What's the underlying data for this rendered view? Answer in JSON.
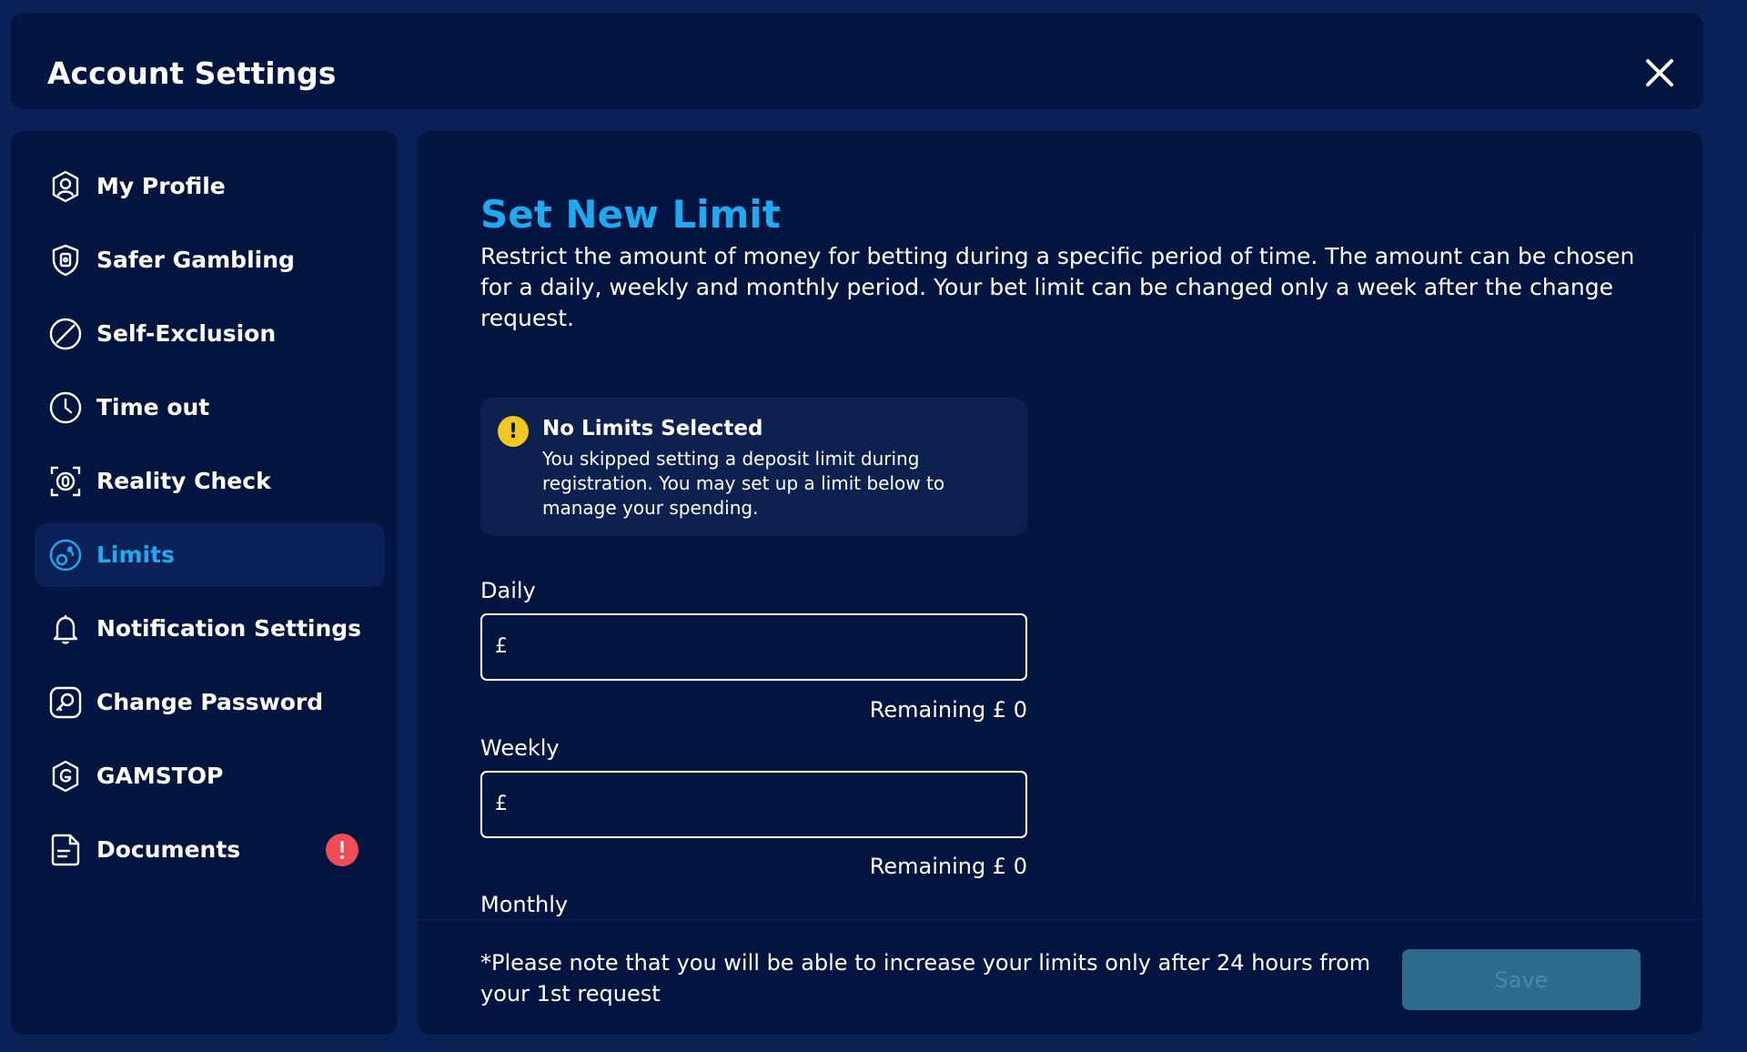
{
  "header": {
    "title": "Account Settings",
    "close_icon": "close-icon"
  },
  "sidebar": {
    "items": [
      {
        "label": "My Profile",
        "icon": "user-icon"
      },
      {
        "label": "Safer Gambling",
        "icon": "shield-icon"
      },
      {
        "label": "Self-Exclusion",
        "icon": "block-icon"
      },
      {
        "label": "Time out",
        "icon": "clock-icon"
      },
      {
        "label": "Reality Check",
        "icon": "reality-check-icon"
      },
      {
        "label": "Limits",
        "icon": "limits-icon",
        "active": true
      },
      {
        "label": "Notification Settings",
        "icon": "bell-icon"
      },
      {
        "label": "Change Password",
        "icon": "key-icon"
      },
      {
        "label": "GAMSTOP",
        "icon": "gamstop-icon"
      },
      {
        "label": "Documents",
        "icon": "document-icon",
        "badge": "!"
      }
    ]
  },
  "main": {
    "title": "Set New Limit",
    "description": "Restrict the amount of money for betting during a specific period of time. The amount can be chosen for a daily, weekly and monthly period. Your bet limit can be changed only a week after the change request.",
    "alert": {
      "icon": "!",
      "title": "No Limits Selected",
      "text": "You skipped setting a deposit limit during registration. You may set up a limit below to manage your spending."
    },
    "fields": [
      {
        "label": "Daily",
        "currency": "£",
        "value": "",
        "remaining": "Remaining £ 0"
      },
      {
        "label": "Weekly",
        "currency": "£",
        "value": "",
        "remaining": "Remaining £ 0"
      },
      {
        "label": "Monthly"
      }
    ]
  },
  "footer": {
    "note": "*Please note that you will be able to increase your limits only after 24 hours from your 1st request",
    "save_label": "Save"
  },
  "colors": {
    "background": "#0a2258",
    "panel": "#021540",
    "accent": "#1fa9f0",
    "warning": "#f3c620",
    "danger": "#f04d56",
    "save_button": "#2d6b8c"
  }
}
